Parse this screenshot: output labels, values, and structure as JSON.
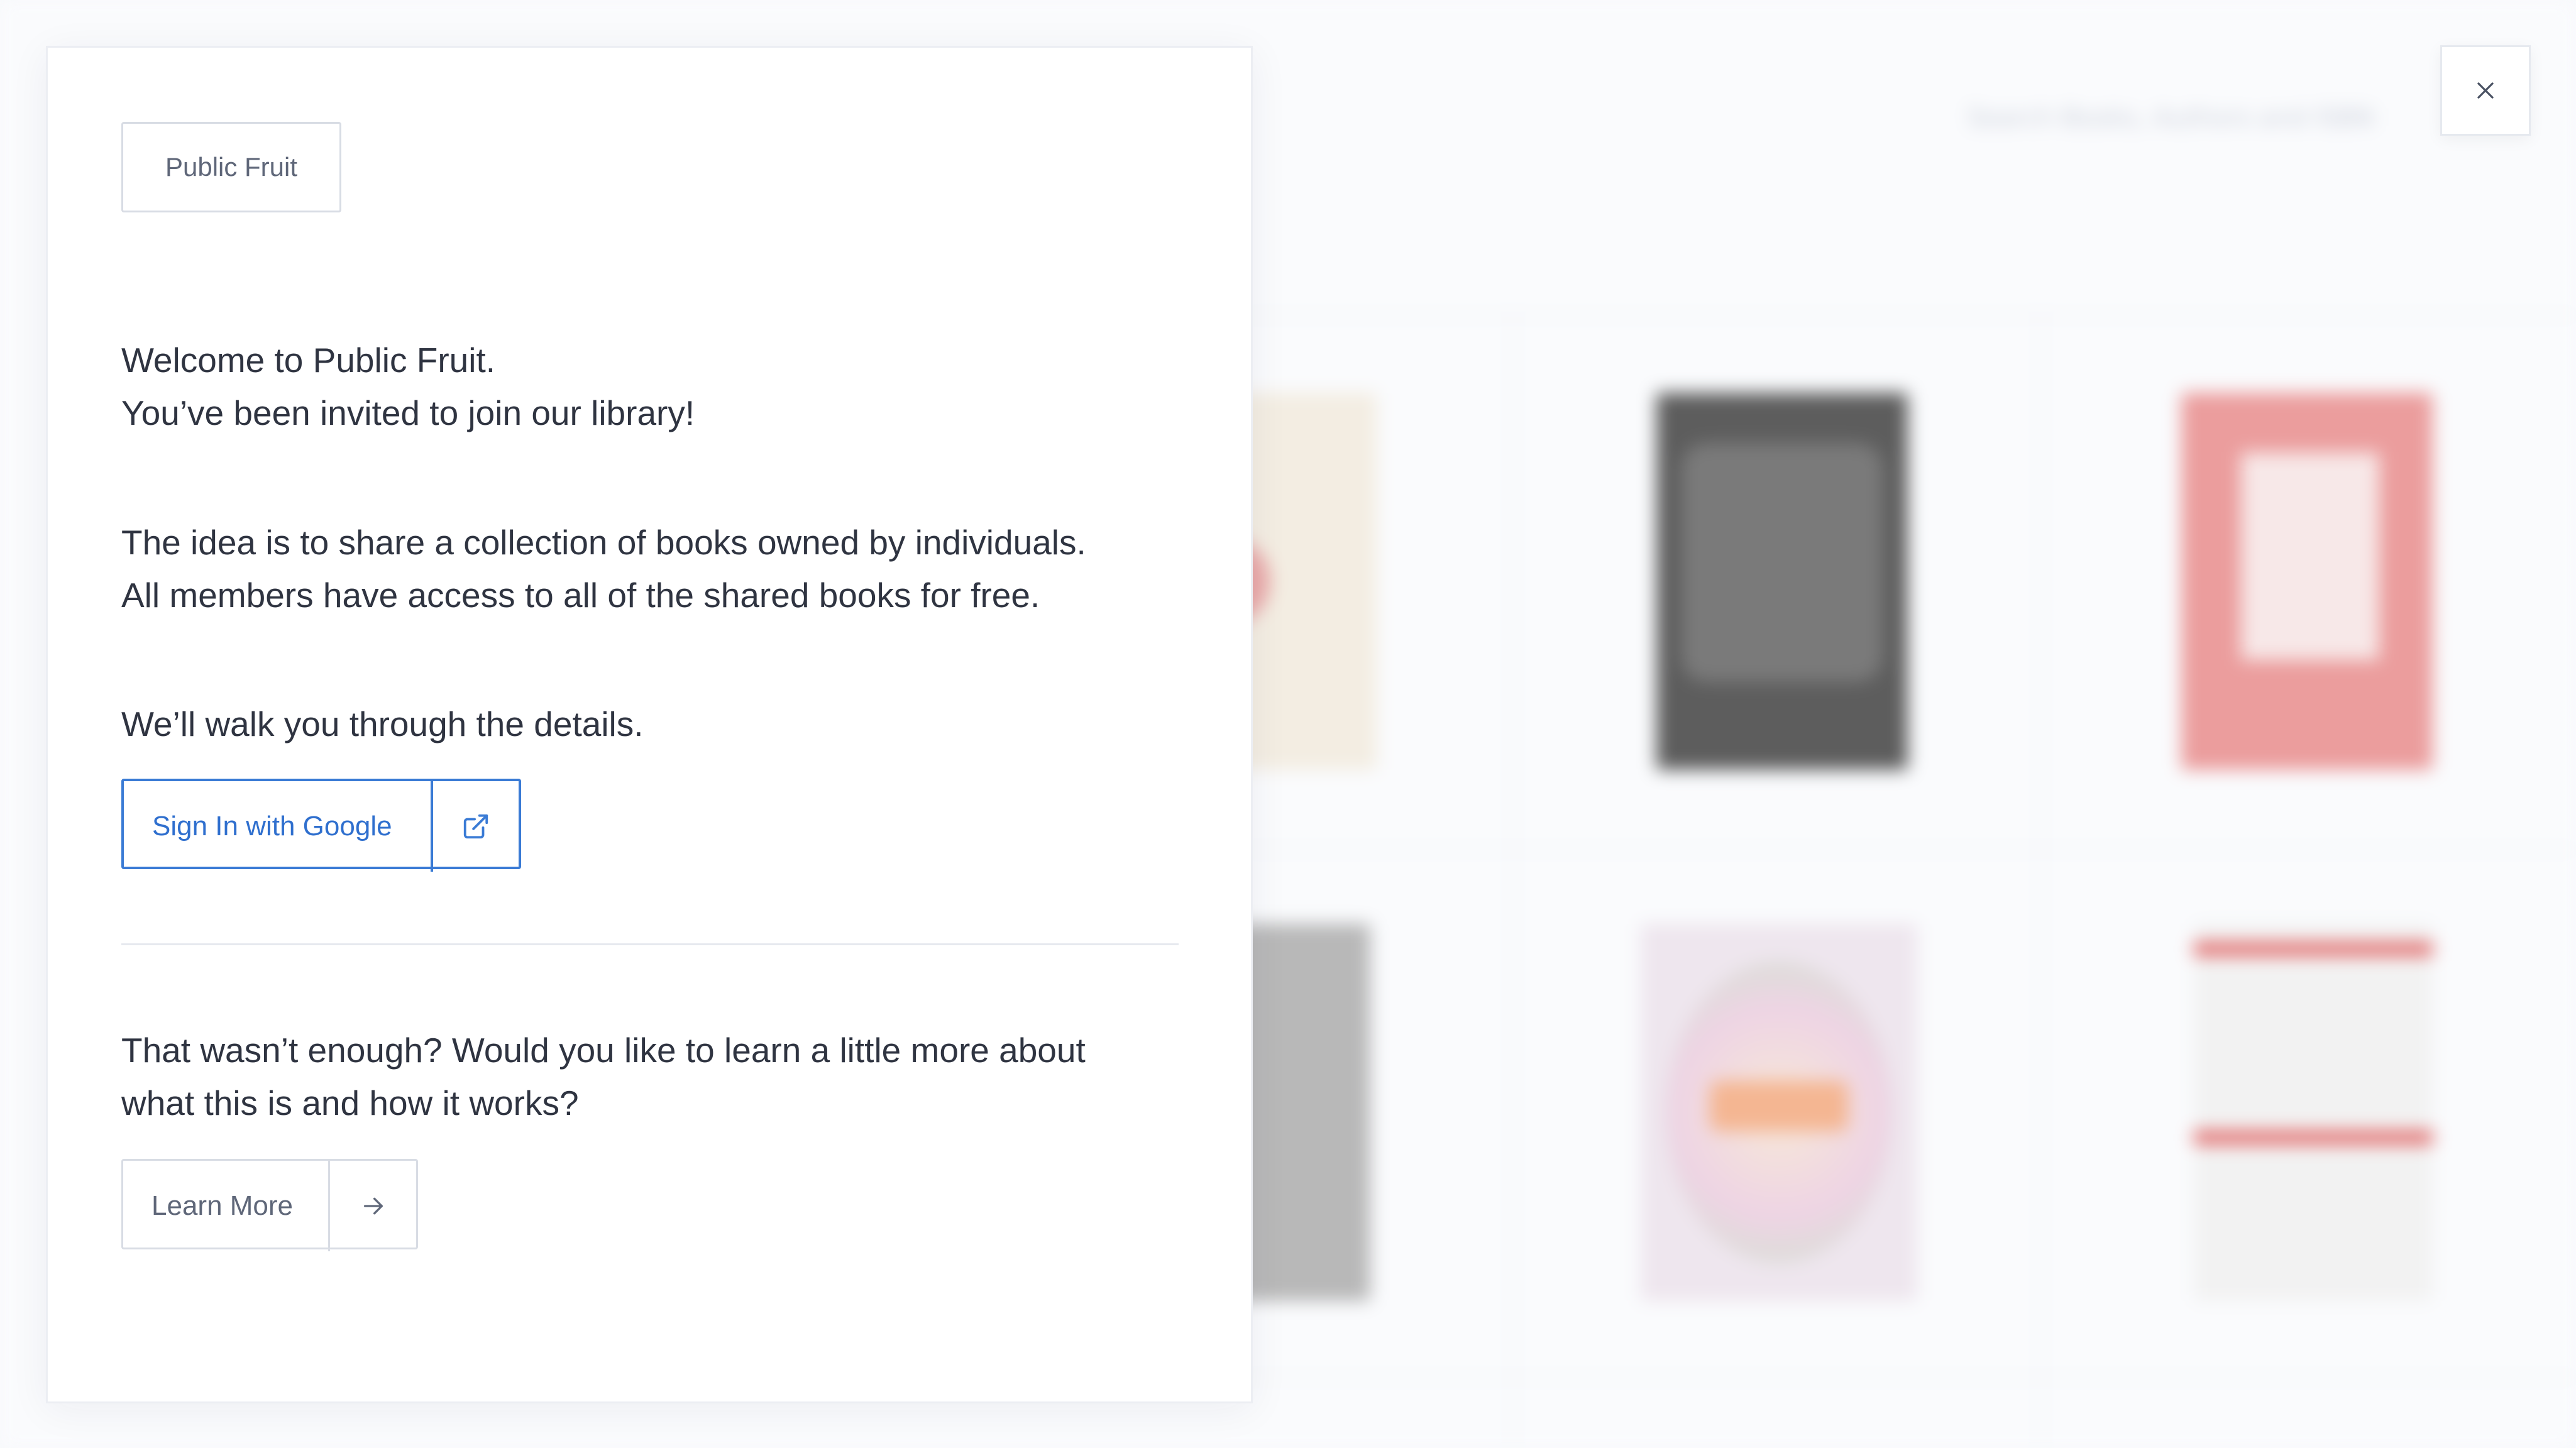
{
  "background": {
    "search_placeholder": "Search Books, Authors and ISBN",
    "book_covers": [
      {
        "name": "book-cover-1",
        "accent": "#e9a7a7"
      },
      {
        "name": "book-cover-2",
        "accent": "#5d5d5d"
      },
      {
        "name": "book-cover-3",
        "accent": "#eb9d9d"
      },
      {
        "name": "book-cover-4",
        "accent": "#b8b8b8"
      },
      {
        "name": "book-cover-east",
        "accent": "#f4b692"
      },
      {
        "name": "book-cover-6",
        "accent": "#e06060"
      }
    ]
  },
  "close_button": {
    "icon": "close-icon"
  },
  "modal": {
    "brand_label": "Public Fruit",
    "welcome_line_1": "Welcome to Public Fruit.",
    "welcome_line_2": "You’ve been invited to join our library!",
    "idea_line_1": "The idea is to share a collection of books owned by individuals.",
    "idea_line_2": "All members have access to all of the shared books for free.",
    "walk_through": "We’ll walk you through the details.",
    "signin_button": {
      "label": "Sign In with Google",
      "icon": "external-link-icon",
      "color": "#3a7bd5"
    },
    "more_line_1": "That wasn’t enough? Would you like to learn a little more about",
    "more_line_2": "what this is and how it works?",
    "learn_button": {
      "label": "Learn More",
      "icon": "arrow-right-icon"
    }
  }
}
